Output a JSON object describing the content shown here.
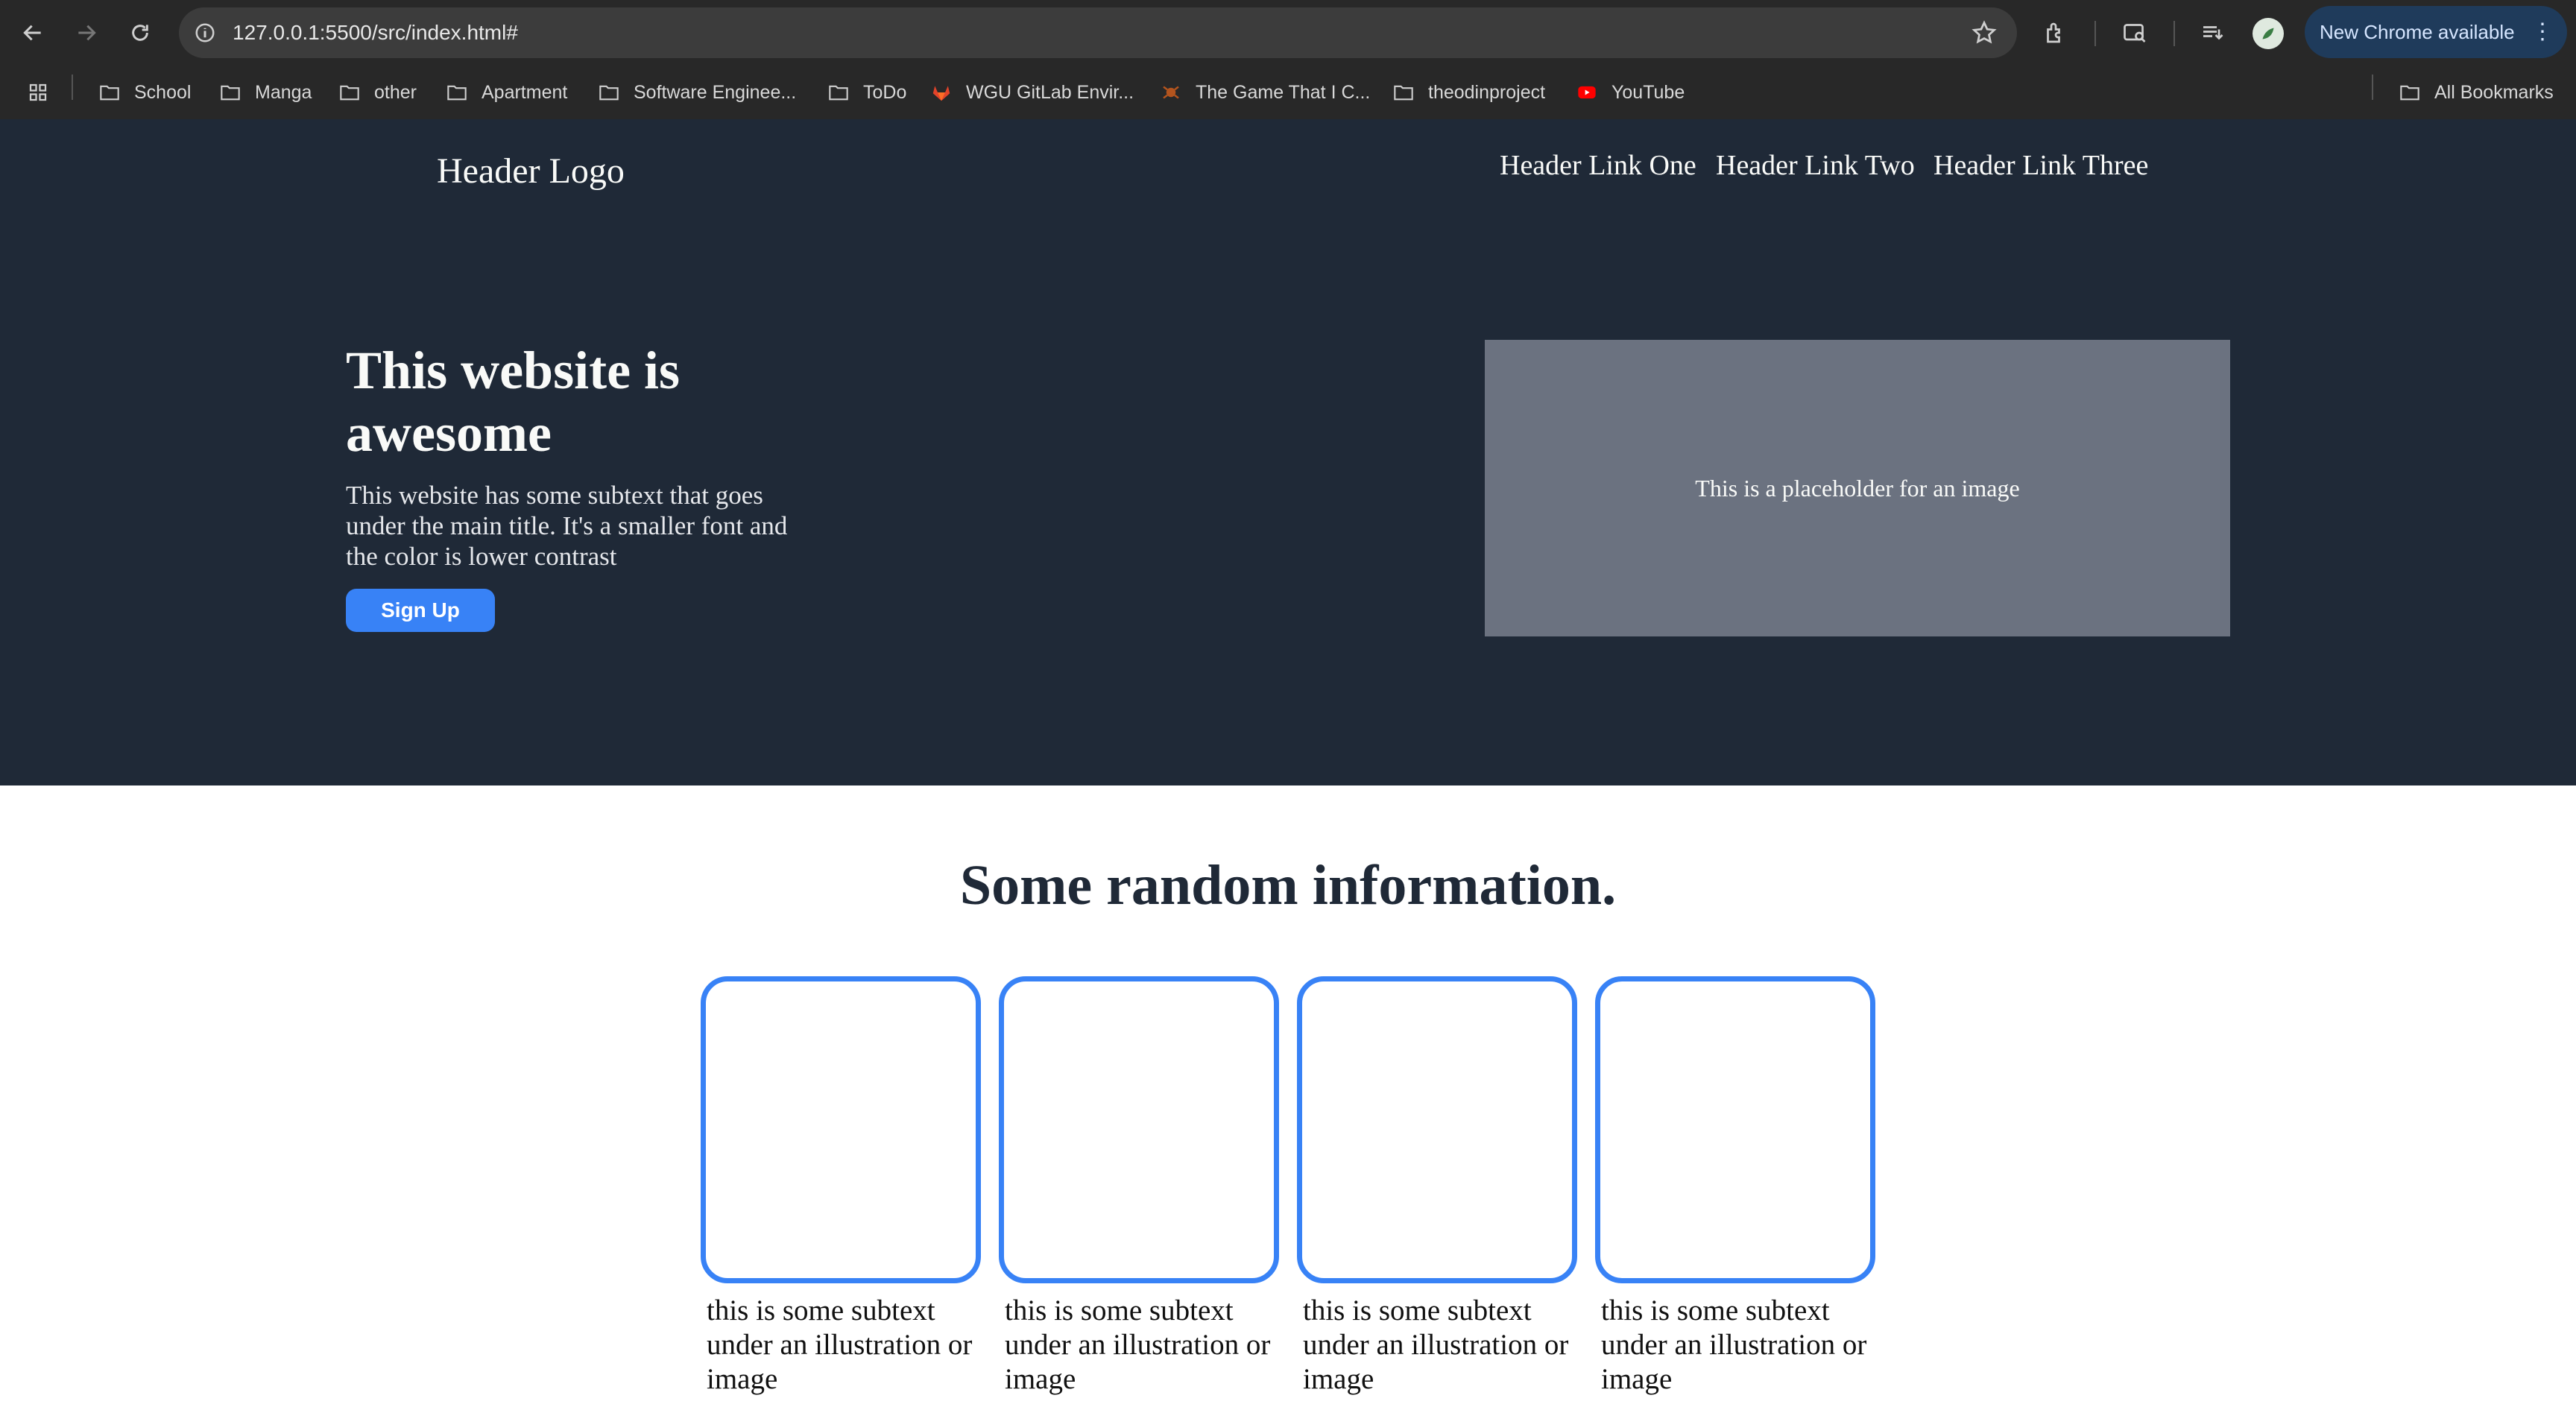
{
  "browser": {
    "url": "127.0.0.1:5500/src/index.html#",
    "update_label": "New Chrome available",
    "update_menu": "⋮",
    "bookmarks": [
      {
        "label": "School",
        "icon": "folder-icon"
      },
      {
        "label": "Manga",
        "icon": "folder-icon"
      },
      {
        "label": "other",
        "icon": "folder-icon"
      },
      {
        "label": "Apartment",
        "icon": "folder-icon"
      },
      {
        "label": "Software Enginee...",
        "icon": "folder-icon"
      },
      {
        "label": "ToDo",
        "icon": "folder-icon"
      },
      {
        "label": "WGU GitLab Envir...",
        "icon": "gitlab-icon"
      },
      {
        "label": "The Game That I C...",
        "icon": "game-favicon-icon"
      },
      {
        "label": "theodinproject",
        "icon": "folder-icon"
      },
      {
        "label": "YouTube",
        "icon": "youtube-icon"
      }
    ],
    "all_bookmarks": "All Bookmarks",
    "accent_color": "#1f3b5b"
  },
  "header": {
    "logo": "Header Logo",
    "links": [
      "Header Link One",
      "Header Link Two",
      "Header Link Three"
    ]
  },
  "hero": {
    "title": "This website is awesome",
    "subtext": "This website has some subtext that goes under the main title. It's a smaller font and the color is lower contrast",
    "button_label": "Sign Up",
    "image_placeholder": "This is a placeholder for an image",
    "background_color": "#1f2937",
    "button_color": "#3882f6"
  },
  "info": {
    "title": "Some random information.",
    "cards": [
      {
        "caption": "this is some subtext under an illustration or image"
      },
      {
        "caption": "this is some subtext under an illustration or image"
      },
      {
        "caption": "this is some subtext under an illustration or image"
      },
      {
        "caption": "this is some subtext under an illustration or image"
      }
    ]
  }
}
